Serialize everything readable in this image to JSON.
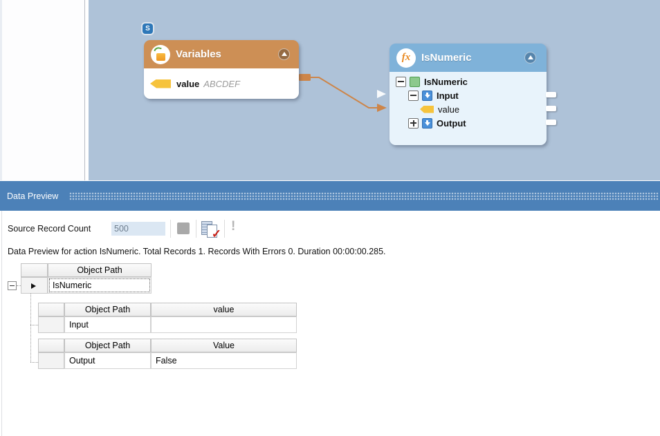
{
  "icons": {
    "s_badge": "S",
    "fx_label": "fx",
    "row_marker": "validate_check_and_marker_rendered_as_css",
    "validate_check": "✓",
    "exclamation": "!"
  },
  "canvas": {
    "variables_node": {
      "title": "Variables",
      "field_name": "value",
      "field_value": "ABCDEF"
    },
    "isnumeric_node": {
      "title": "IsNumeric",
      "rows": [
        {
          "label": "IsNumeric"
        },
        {
          "label": "Input"
        },
        {
          "label": "value"
        },
        {
          "label": "Output"
        }
      ]
    }
  },
  "preview": {
    "title": "Data Preview",
    "toolbar": {
      "count_label": "Source Record Count",
      "count_value": "500"
    },
    "message": "Data Preview for action IsNumeric. Total Records 1. Records With Errors 0. Duration 00:00:00.285.",
    "grid": {
      "root": {
        "header": "Object Path",
        "row_label": "IsNumeric"
      },
      "input_table": {
        "header_path": "Object Path",
        "header_value": "value",
        "row_path": "Input",
        "row_value": ""
      },
      "output_table": {
        "header_path": "Object Path",
        "header_value": "Value",
        "row_path": "Output",
        "row_value": "False"
      }
    }
  },
  "colors": {
    "canvas_bg": "#aec2d8",
    "variables_header": "#cd8f55",
    "isnumeric_header": "#7fb2d9",
    "isnumeric_body": "#e8f3fb",
    "connector_orange": "#cd8549",
    "titlebar_blue": "#4c81b8",
    "tag_yellow": "#f6c33c",
    "green_square": "#8cc98c",
    "blue_square": "#4a90d9"
  }
}
